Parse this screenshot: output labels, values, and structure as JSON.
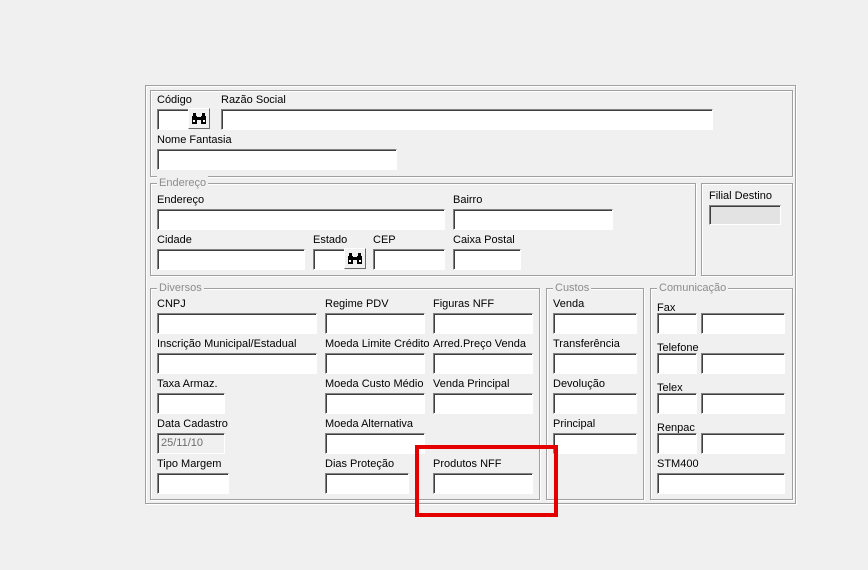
{
  "header": {
    "codigo_label": "Código",
    "codigo_value": "",
    "razao_social_label": "Razão Social",
    "razao_social_value": "",
    "nome_fantasia_label": "Nome Fantasia",
    "nome_fantasia_value": ""
  },
  "endereco": {
    "legend": "Endereço",
    "endereco_label": "Endereço",
    "bairro_label": "Bairro",
    "cidade_label": "Cidade",
    "estado_label": "Estado",
    "cep_label": "CEP",
    "caixa_postal_label": "Caixa Postal"
  },
  "filial": {
    "label": "Filial Destino",
    "value": ""
  },
  "diversos": {
    "legend": "Diversos",
    "cnpj_label": "CNPJ",
    "regime_pdv_label": "Regime PDV",
    "figuras_nff_label": "Figuras NFF",
    "inscricao_label": "Inscrição Municipal/Estadual",
    "moeda_limite_credito_label": "Moeda Limite Crédito",
    "arred_preco_venda_label": "Arred.Preço Venda",
    "taxa_armaz_label": "Taxa Armaz.",
    "moeda_custo_medio_label": "Moeda Custo Médio",
    "venda_principal_label": "Venda Principal",
    "data_cadastro_label": "Data Cadastro",
    "data_cadastro_value": "25/11/10",
    "moeda_alternativa_label": "Moeda Alternativa",
    "tipo_margem_label": "Tipo Margem",
    "dias_protecao_label": "Dias Proteção",
    "produtos_nff_label": "Produtos NFF"
  },
  "custos": {
    "legend": "Custos",
    "venda_label": "Venda",
    "transferencia_label": "Transferência",
    "devolucao_label": "Devolução",
    "principal_label": "Principal"
  },
  "comunicacao": {
    "legend": "Comunicação",
    "fax_label": "Fax",
    "telefone_label": "Telefone",
    "telex_label": "Telex",
    "renpac_label": "Renpac",
    "stm400_label": "STM400"
  },
  "colors": {
    "highlight": "#e50000",
    "window_bg": "#f0f0f0"
  },
  "icons": {
    "search": "binoculars-icon"
  }
}
